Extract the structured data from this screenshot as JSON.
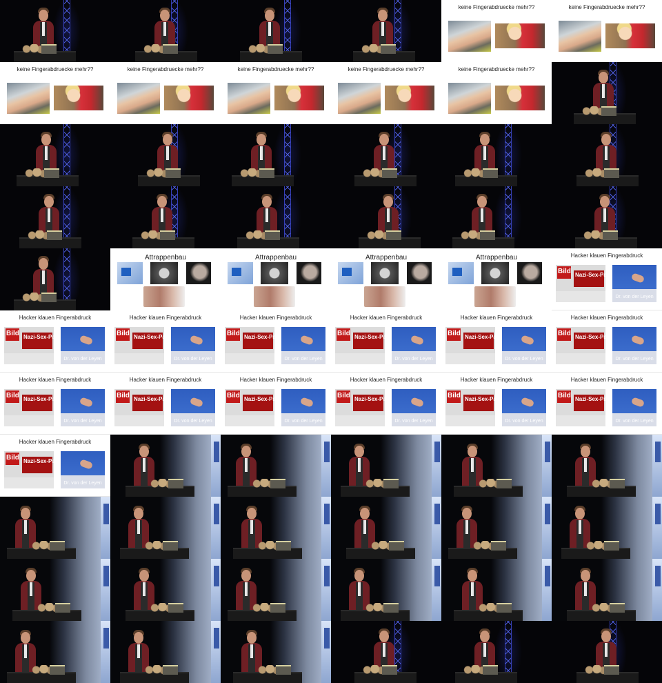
{
  "slides": {
    "fingerprint_title": "keine Fingerabdruecke mehr??",
    "dummy_title": "Attrappenbau",
    "hacker_title": "Hacker klauen Fingerabdruck",
    "newspaper_brand": "Bild",
    "newspaper_headline": "Nazi-Sex-Party",
    "caption": "Dr. von der Leyen"
  },
  "grid": {
    "columns": 6,
    "rows": 11,
    "frames": [
      "stage",
      "stage",
      "stage",
      "stage",
      "fingerprint",
      "fingerprint",
      "fingerprint",
      "fingerprint",
      "fingerprint",
      "fingerprint",
      "fingerprint",
      "stage",
      "stage",
      "stage",
      "stage",
      "stage",
      "stage",
      "stage",
      "stage",
      "stage",
      "stage",
      "stage",
      "stage",
      "stage",
      "stage",
      "dummy",
      "dummy",
      "dummy",
      "dummy",
      "hacker",
      "hacker",
      "hacker",
      "hacker",
      "hacker",
      "hacker",
      "hacker",
      "hacker",
      "hacker",
      "hacker",
      "hacker",
      "hacker",
      "hacker",
      "hacker",
      "screen",
      "screen",
      "screen",
      "screen",
      "screen",
      "screen",
      "screen",
      "screen",
      "screen",
      "screen",
      "screen",
      "screen",
      "screen",
      "screen",
      "screen",
      "screen",
      "screen",
      "screen",
      "screen",
      "screen",
      "stage",
      "stage",
      "stage"
    ]
  },
  "colors": {
    "truss": "#4b5ad6",
    "jacket": "#6e1f24",
    "slide_background": "#ffffff"
  }
}
